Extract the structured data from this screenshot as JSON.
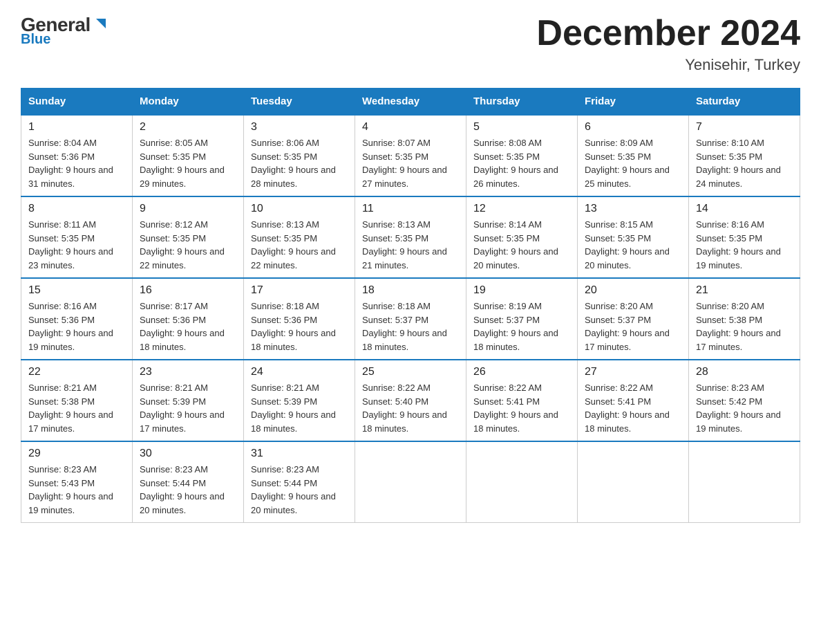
{
  "header": {
    "logo_general": "General",
    "logo_blue": "Blue",
    "month_year": "December 2024",
    "location": "Yenisehir, Turkey"
  },
  "days_of_week": [
    "Sunday",
    "Monday",
    "Tuesday",
    "Wednesday",
    "Thursday",
    "Friday",
    "Saturday"
  ],
  "weeks": [
    [
      {
        "day": "1",
        "sunrise": "8:04 AM",
        "sunset": "5:36 PM",
        "daylight": "9 hours and 31 minutes."
      },
      {
        "day": "2",
        "sunrise": "8:05 AM",
        "sunset": "5:35 PM",
        "daylight": "9 hours and 29 minutes."
      },
      {
        "day": "3",
        "sunrise": "8:06 AM",
        "sunset": "5:35 PM",
        "daylight": "9 hours and 28 minutes."
      },
      {
        "day": "4",
        "sunrise": "8:07 AM",
        "sunset": "5:35 PM",
        "daylight": "9 hours and 27 minutes."
      },
      {
        "day": "5",
        "sunrise": "8:08 AM",
        "sunset": "5:35 PM",
        "daylight": "9 hours and 26 minutes."
      },
      {
        "day": "6",
        "sunrise": "8:09 AM",
        "sunset": "5:35 PM",
        "daylight": "9 hours and 25 minutes."
      },
      {
        "day": "7",
        "sunrise": "8:10 AM",
        "sunset": "5:35 PM",
        "daylight": "9 hours and 24 minutes."
      }
    ],
    [
      {
        "day": "8",
        "sunrise": "8:11 AM",
        "sunset": "5:35 PM",
        "daylight": "9 hours and 23 minutes."
      },
      {
        "day": "9",
        "sunrise": "8:12 AM",
        "sunset": "5:35 PM",
        "daylight": "9 hours and 22 minutes."
      },
      {
        "day": "10",
        "sunrise": "8:13 AM",
        "sunset": "5:35 PM",
        "daylight": "9 hours and 22 minutes."
      },
      {
        "day": "11",
        "sunrise": "8:13 AM",
        "sunset": "5:35 PM",
        "daylight": "9 hours and 21 minutes."
      },
      {
        "day": "12",
        "sunrise": "8:14 AM",
        "sunset": "5:35 PM",
        "daylight": "9 hours and 20 minutes."
      },
      {
        "day": "13",
        "sunrise": "8:15 AM",
        "sunset": "5:35 PM",
        "daylight": "9 hours and 20 minutes."
      },
      {
        "day": "14",
        "sunrise": "8:16 AM",
        "sunset": "5:35 PM",
        "daylight": "9 hours and 19 minutes."
      }
    ],
    [
      {
        "day": "15",
        "sunrise": "8:16 AM",
        "sunset": "5:36 PM",
        "daylight": "9 hours and 19 minutes."
      },
      {
        "day": "16",
        "sunrise": "8:17 AM",
        "sunset": "5:36 PM",
        "daylight": "9 hours and 18 minutes."
      },
      {
        "day": "17",
        "sunrise": "8:18 AM",
        "sunset": "5:36 PM",
        "daylight": "9 hours and 18 minutes."
      },
      {
        "day": "18",
        "sunrise": "8:18 AM",
        "sunset": "5:37 PM",
        "daylight": "9 hours and 18 minutes."
      },
      {
        "day": "19",
        "sunrise": "8:19 AM",
        "sunset": "5:37 PM",
        "daylight": "9 hours and 18 minutes."
      },
      {
        "day": "20",
        "sunrise": "8:20 AM",
        "sunset": "5:37 PM",
        "daylight": "9 hours and 17 minutes."
      },
      {
        "day": "21",
        "sunrise": "8:20 AM",
        "sunset": "5:38 PM",
        "daylight": "9 hours and 17 minutes."
      }
    ],
    [
      {
        "day": "22",
        "sunrise": "8:21 AM",
        "sunset": "5:38 PM",
        "daylight": "9 hours and 17 minutes."
      },
      {
        "day": "23",
        "sunrise": "8:21 AM",
        "sunset": "5:39 PM",
        "daylight": "9 hours and 17 minutes."
      },
      {
        "day": "24",
        "sunrise": "8:21 AM",
        "sunset": "5:39 PM",
        "daylight": "9 hours and 18 minutes."
      },
      {
        "day": "25",
        "sunrise": "8:22 AM",
        "sunset": "5:40 PM",
        "daylight": "9 hours and 18 minutes."
      },
      {
        "day": "26",
        "sunrise": "8:22 AM",
        "sunset": "5:41 PM",
        "daylight": "9 hours and 18 minutes."
      },
      {
        "day": "27",
        "sunrise": "8:22 AM",
        "sunset": "5:41 PM",
        "daylight": "9 hours and 18 minutes."
      },
      {
        "day": "28",
        "sunrise": "8:23 AM",
        "sunset": "5:42 PM",
        "daylight": "9 hours and 19 minutes."
      }
    ],
    [
      {
        "day": "29",
        "sunrise": "8:23 AM",
        "sunset": "5:43 PM",
        "daylight": "9 hours and 19 minutes."
      },
      {
        "day": "30",
        "sunrise": "8:23 AM",
        "sunset": "5:44 PM",
        "daylight": "9 hours and 20 minutes."
      },
      {
        "day": "31",
        "sunrise": "8:23 AM",
        "sunset": "5:44 PM",
        "daylight": "9 hours and 20 minutes."
      },
      null,
      null,
      null,
      null
    ]
  ]
}
